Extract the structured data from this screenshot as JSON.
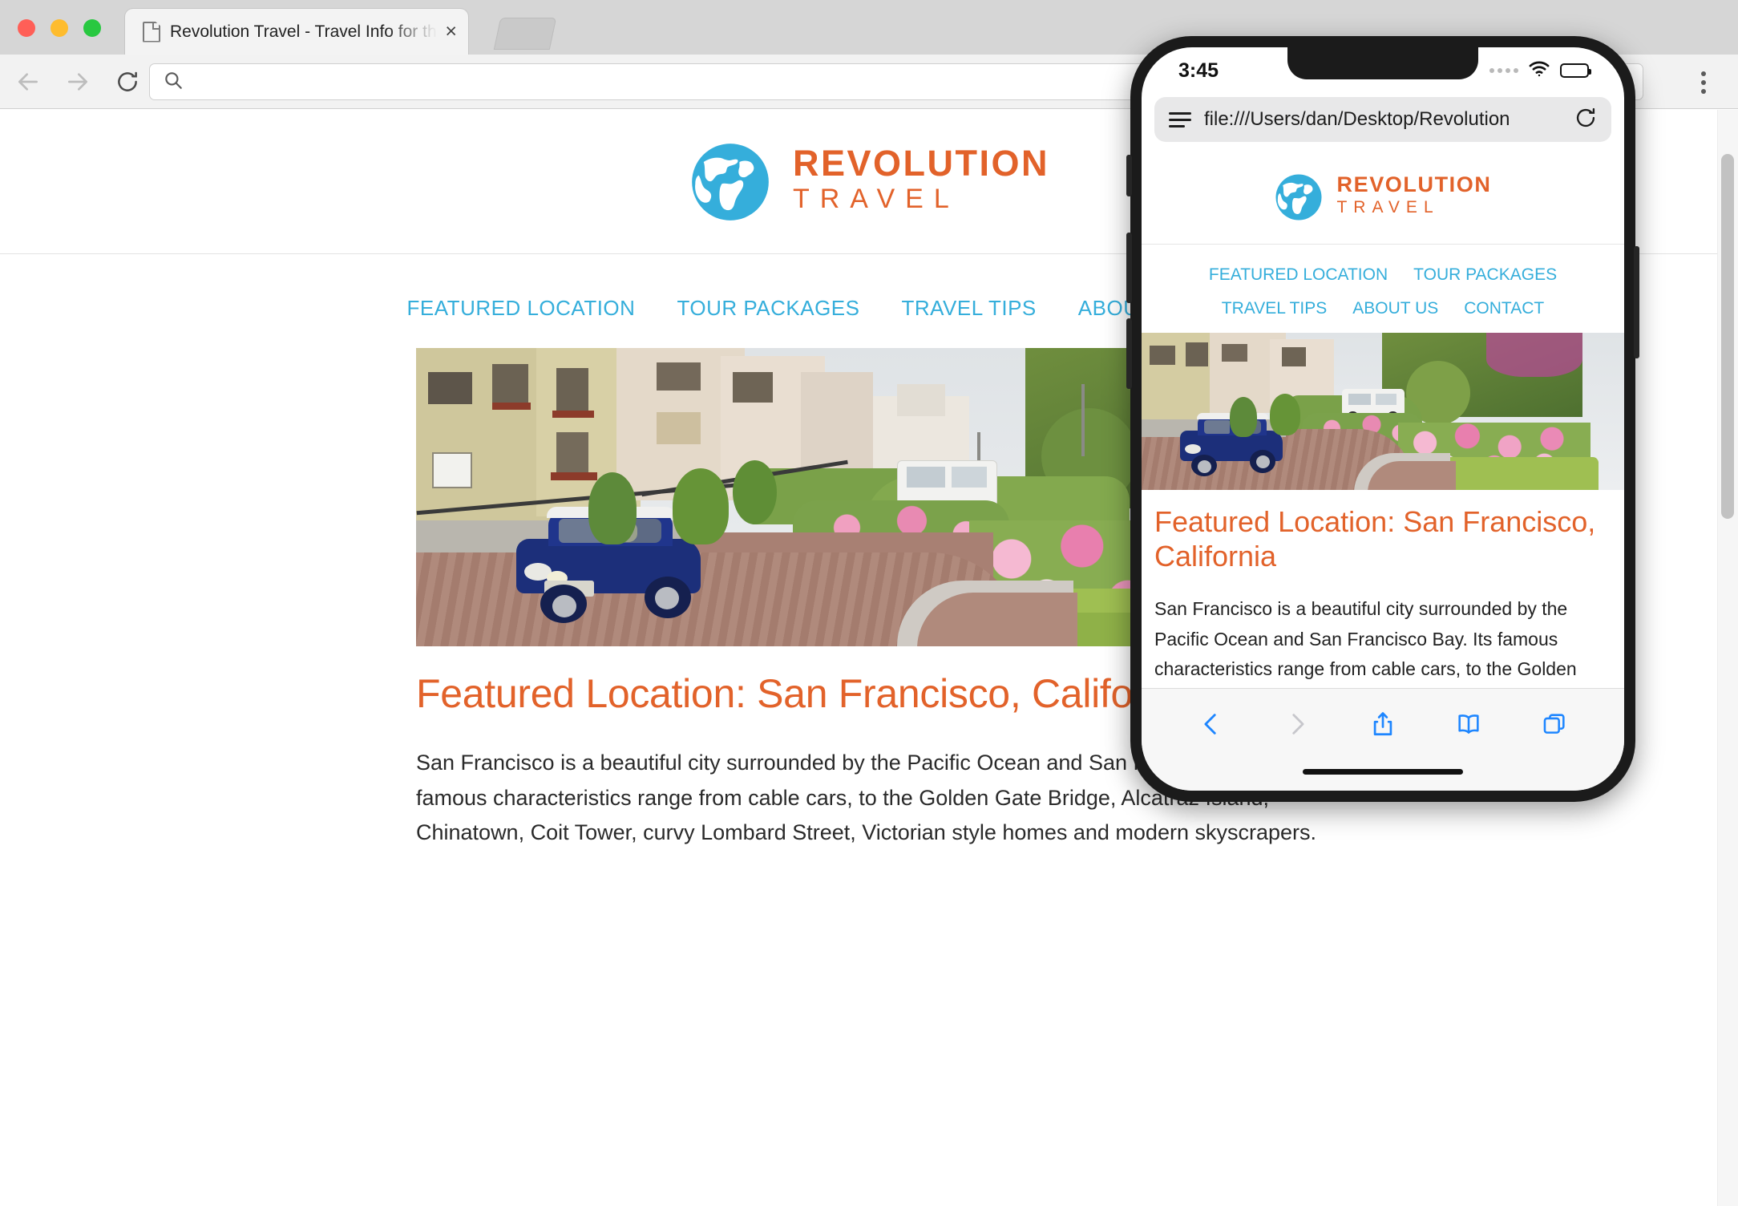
{
  "browser": {
    "tab": {
      "title": "Revolution Travel - Travel Info for the Adventurer",
      "close_label": "×"
    },
    "toolbar": {
      "back_icon": "arrow-left-icon",
      "forward_icon": "arrow-right-icon",
      "reload_icon": "reload-icon",
      "search_icon": "search-icon",
      "omnibox_value": "",
      "omnibox_placeholder": "",
      "menu_icon": "kebab-menu-icon"
    }
  },
  "site": {
    "logo": {
      "name": "REVOLUTION",
      "sub": "TRAVEL",
      "icon": "globe-icon"
    },
    "nav": [
      {
        "label": "FEATURED LOCATION"
      },
      {
        "label": "TOUR PACKAGES"
      },
      {
        "label": "TRAVEL TIPS"
      },
      {
        "label": "ABOUT US"
      },
      {
        "label": "CONTACT"
      }
    ],
    "hero_alt": "Lombard Street San Francisco with blue mini cooper and pink hydrangeas",
    "article": {
      "heading": "Featured Location: San Francisco, California",
      "body": "San Francisco is a beautiful city surrounded by the Pacific Ocean and San Francisco Bay. Its famous characteristics range from cable cars, to the Golden Gate Bridge, Alcatraz Island, Chinatown, Coit Tower, curvy Lombard Street, Victorian style homes and modern skyscrapers."
    }
  },
  "phone": {
    "status": {
      "time": "3:45",
      "wifi_icon": "wifi-icon",
      "battery_icon": "battery-icon",
      "signal_icon": "signal-dots-icon"
    },
    "url_bar": {
      "menu_icon": "reader-menu-icon",
      "url": "file:///Users/dan/Desktop/Revolution",
      "reload_icon": "reload-icon"
    },
    "toolbar": [
      {
        "icon": "back-chevron-icon",
        "enabled": true
      },
      {
        "icon": "forward-chevron-icon",
        "enabled": false
      },
      {
        "icon": "share-icon",
        "enabled": true
      },
      {
        "icon": "bookmarks-icon",
        "enabled": true
      },
      {
        "icon": "tabs-icon",
        "enabled": true
      }
    ]
  },
  "colors": {
    "brand_orange": "#e2622a",
    "brand_blue": "#35aedb",
    "ios_blue": "#1e86ff",
    "tab_bg": "#f3f3f3",
    "chrome_bg": "#d6d6d6"
  }
}
